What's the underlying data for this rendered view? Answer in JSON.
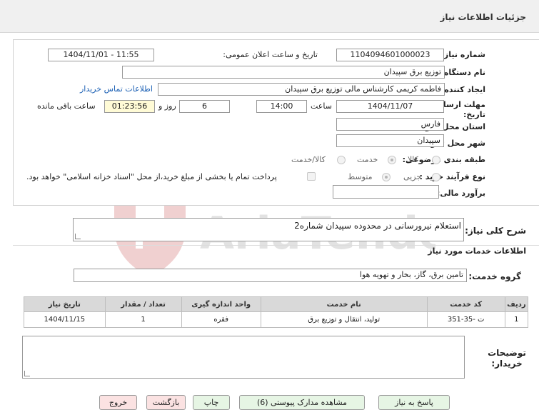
{
  "header": {
    "title": "جزئیات اطلاعات نیاز"
  },
  "form": {
    "need_number": {
      "label": "شماره نیاز:",
      "value": "1104094601000023"
    },
    "announce": {
      "label": "تاریخ و ساعت اعلان عمومی:",
      "value": "1404/11/01 - 11:55"
    },
    "buyer_org": {
      "label": "نام دستگاه خریدار:",
      "value": "توزیع برق سپیدان"
    },
    "requester": {
      "label": "ایجاد کننده درخواست:",
      "value": "فاطمه کریمی کارشناس مالی توزیع برق سپیدان",
      "contact_link": "اطلاعات تماس خریدار"
    },
    "deadline": {
      "label_line1": "مهلت ارسال پاسخ: تا",
      "label_line2": "تاریخ:",
      "date": "1404/11/07",
      "time_label": "ساعت",
      "time": "14:00",
      "days": "6",
      "days_label": "روز و",
      "remaining": "01:23:56",
      "remaining_label": "ساعت باقی مانده"
    },
    "province": {
      "label": "استان محل تحویل:",
      "value": "فارس"
    },
    "city": {
      "label": "شهر محل تحویل:",
      "value": "سپیدان"
    },
    "category": {
      "label": "طبقه بندی موضوعی:",
      "options": [
        "کالا",
        "خدمت",
        "کالا/خدمت"
      ],
      "selected": "خدمت"
    },
    "purchase_type": {
      "label": "نوع فرآیند خرید :",
      "options": [
        "جزیی",
        "متوسط"
      ],
      "selected": "متوسط",
      "note": "پرداخت تمام یا بخشی از مبلغ خرید،از محل \"اسناد خزانه اسلامی\" خواهد بود."
    },
    "budget": {
      "label": "برآورد مالی:",
      "value": ""
    }
  },
  "description": {
    "label": "شرح کلی نیاز:",
    "value": "استعلام نیرورسانی در محدوده سپیدان شماره2"
  },
  "services": {
    "section_title": "اطلاعات خدمات مورد نیاز",
    "group_label": "گروه خدمت:",
    "group_value": "تامین برق، گاز، بخار و تهویه هوا",
    "table": {
      "headers": [
        "ردیف",
        "کد خدمت",
        "نام خدمت",
        "واحد اندازه گیری",
        "تعداد / مقدار",
        "تاریخ نیاز"
      ],
      "rows": [
        [
          "1",
          "ت -35-351",
          "تولید، انتقال و توزیع برق",
          "فقره",
          "1",
          "1404/11/15"
        ]
      ]
    }
  },
  "buyer_notes": {
    "label": "توضیحات خریدار:",
    "value": ""
  },
  "buttons": {
    "reply": "پاسخ به نیاز",
    "attachments": "مشاهده مدارک پیوستی (6)",
    "print": "چاپ",
    "back": "بازگشت",
    "exit": "خروج"
  },
  "watermark": {
    "text": "AriaTender.neT"
  }
}
